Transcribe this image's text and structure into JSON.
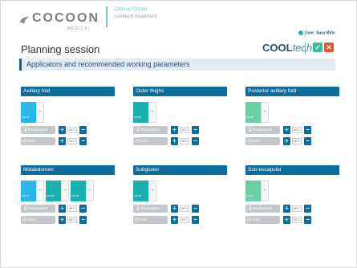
{
  "header": {
    "logo_text": "COCOON",
    "logo_sub": "MEDICAL",
    "clinic_name": "Clinical Center",
    "clinic_sub": "cooltech treatment",
    "user": "User: Sara Mills"
  },
  "page_title": "Planning session",
  "brand": {
    "cool": "COOL",
    "tech": "tech"
  },
  "section_title": "Applicators and recommended working parameters",
  "labels": {
    "temperature": "Temperature",
    "time": "Time",
    "value": "00°C",
    "ok": "✓",
    "close": "✕",
    "plus": "+",
    "minus": "−"
  },
  "groups": [
    {
      "name": "Axillary fold",
      "tiles": [
        {
          "label": "Tight HP",
          "color": "#29b6e8"
        }
      ]
    },
    {
      "name": "Outer thighs",
      "tiles": [
        {
          "label": "Oval HP",
          "color": "#1ab0b0"
        }
      ]
    },
    {
      "name": "Posterior axillary fold",
      "tiles": [
        {
          "label": "Tiny HP",
          "color": "#6ad0a4"
        }
      ]
    },
    {
      "name": "Midabdomen",
      "tiles": [
        {
          "label": "Tight HP",
          "color": "#29b6e8"
        },
        {
          "label": "Oval HP",
          "color": "#1ab0b0"
        },
        {
          "label": "Oval HP",
          "color": "#1ab0b0"
        }
      ]
    },
    {
      "name": "Subgluteo",
      "tiles": [
        {
          "label": "Oval HP",
          "color": "#1ab0b0"
        }
      ]
    },
    {
      "name": "Sub-escapular",
      "tiles": [
        {
          "label": "Tiny HP",
          "color": "#6ad0a4"
        }
      ]
    }
  ]
}
